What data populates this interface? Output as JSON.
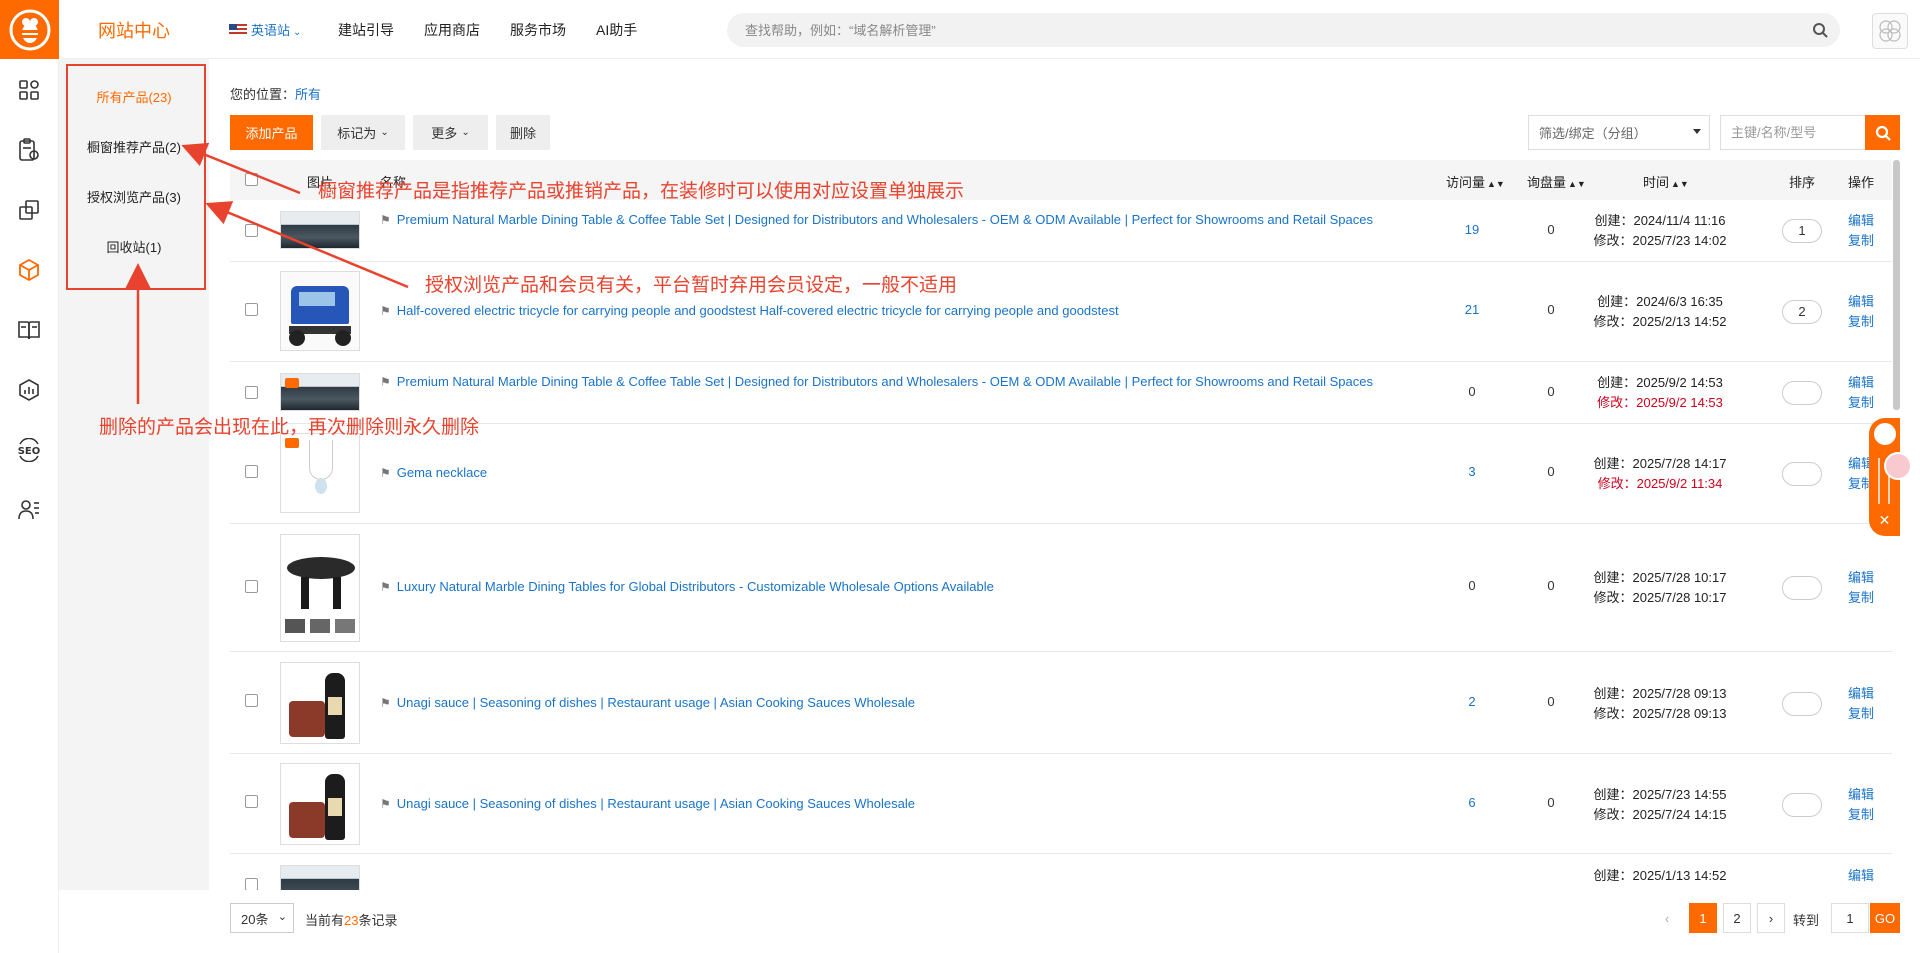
{
  "header": {
    "site_center": "网站中心",
    "nav": {
      "language": "英语站",
      "guide": "建站引导",
      "app_store": "应用商店",
      "service_market": "服务市场",
      "ai": "AI助手"
    },
    "search_placeholder": "查找帮助，例如：“域名解析管理”"
  },
  "rail_icons": [
    "dashboard-icon",
    "assessment-icon",
    "pages-icon",
    "product-box-icon",
    "book-icon",
    "analytics-icon",
    "seo-icon",
    "members-icon"
  ],
  "sidebar": {
    "items": [
      {
        "label": "所有产品(23)"
      },
      {
        "label": "橱窗推荐产品(2)"
      },
      {
        "label": "授权浏览产品(3)"
      },
      {
        "label": "回收站(1)"
      }
    ]
  },
  "breadcrumb": {
    "prefix": "您的位置：",
    "current": "所有"
  },
  "toolbar": {
    "add": "添加产品",
    "mark_as": "标记为",
    "more": "更多",
    "delete": "删除",
    "filter": "筛选/绑定（分组）",
    "keyword_placeholder": "主键/名称/型号"
  },
  "table": {
    "headers": {
      "image": "图片",
      "name": "名称",
      "visits": "访问量",
      "inquiries": "询盘量",
      "time": "时间",
      "order": "排序",
      "actions": "操作"
    },
    "rows": [
      {
        "name": "Premium Natural Marble Dining Table & Coffee Table Set | Designed for Distributors and Wholesalers - OEM & ODM Available | Perfect for Showrooms and Retail Spaces",
        "visits": "19",
        "inquiries": "0",
        "created": "创建：2024/11/4 11:16",
        "modified": "修改：2025/7/23 14:02",
        "modified_red": false,
        "order": "1"
      },
      {
        "name": "Half-covered electric tricycle for carrying people and goodstest Half-covered electric tricycle for carrying people and goodstest",
        "visits": "21",
        "inquiries": "0",
        "created": "创建：2024/6/3 16:35",
        "modified": "修改：2025/2/13 14:52",
        "modified_red": false,
        "order": "2"
      },
      {
        "name": "Premium Natural Marble Dining Table & Coffee Table Set | Designed for Distributors and Wholesalers - OEM & ODM Available | Perfect for Showrooms and Retail Spaces",
        "visits": "0",
        "inquiries": "0",
        "created": "创建：2025/9/2 14:53",
        "modified": "修改：2025/9/2 14:53",
        "modified_red": true,
        "order": ""
      },
      {
        "name": "Gema necklace",
        "visits": "3",
        "inquiries": "0",
        "created": "创建：2025/7/28 14:17",
        "modified": "修改：2025/9/2 11:34",
        "modified_red": true,
        "order": ""
      },
      {
        "name": "Luxury Natural Marble Dining Tables for Global Distributors - Customizable Wholesale Options Available",
        "visits": "0",
        "inquiries": "0",
        "created": "创建：2025/7/28 10:17",
        "modified": "修改：2025/7/28 10:17",
        "modified_red": false,
        "order": ""
      },
      {
        "name": "Unagi sauce | Seasoning of dishes | Restaurant usage | Asian Cooking Sauces Wholesale",
        "visits": "2",
        "inquiries": "0",
        "created": "创建：2025/7/28 09:13",
        "modified": "修改：2025/7/28 09:13",
        "modified_red": false,
        "order": ""
      },
      {
        "name": "Unagi sauce | Seasoning of dishes | Restaurant usage | Asian Cooking Sauces Wholesale",
        "visits": "6",
        "inquiries": "0",
        "created": "创建：2025/7/23 14:55",
        "modified": "修改：2025/7/24 14:15",
        "modified_red": false,
        "order": ""
      },
      {
        "name": "",
        "visits": "",
        "inquiries": "",
        "created": "创建：2025/1/13 14:52",
        "modified": "",
        "modified_red": false,
        "order": ""
      }
    ],
    "edit": "编辑",
    "copy": "复制"
  },
  "pager": {
    "page_size": "20条",
    "total_prefix": "当前有",
    "total_count": "23",
    "total_suffix": "条记录",
    "pages": [
      "1",
      "2"
    ],
    "goto_label": "转到",
    "goto_value": "1",
    "go": "GO"
  },
  "annotations": {
    "showcase": "橱窗推荐产品是指推荐产品或推销产品，在装修时可以使用对应设置单独展示",
    "authorized": "授权浏览产品和会员有关，平台暂时弃用会员设定，一般不适用",
    "recycle": "删除的产品会出现在此，再次删除则永久删除"
  },
  "colors": {
    "accent": "#ff6a00",
    "link": "#1a73c8",
    "annotation": "#e8432e",
    "modified_red": "#d0021b"
  }
}
